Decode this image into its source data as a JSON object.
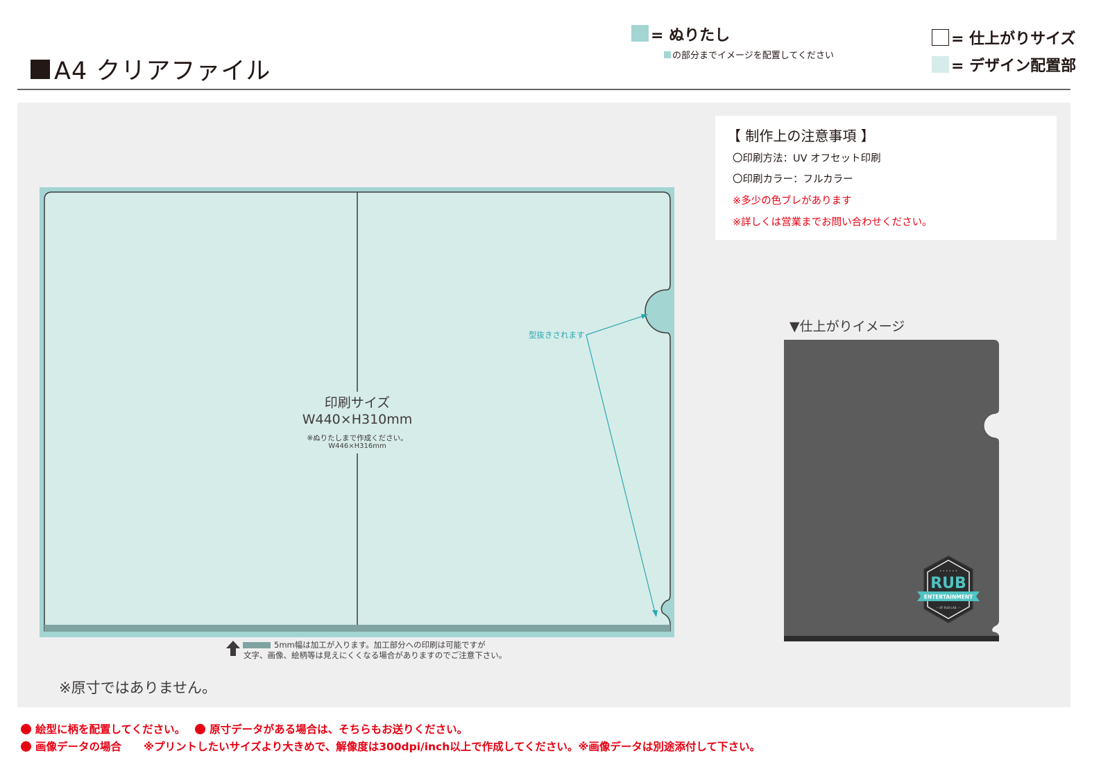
{
  "header": {
    "title": "A4 クリアファイル",
    "legend": {
      "bleed_label": "= ぬりたし",
      "bleed_note": "の部分までイメージを配置してください",
      "finish_label": "= 仕上がりサイズ",
      "design_label": "= デザイン配置部"
    }
  },
  "template": {
    "print_size_label": "印刷サイズ",
    "print_size_dims": "W440×H310mm",
    "bleed_note": "※ぬりたしまで作成ください。",
    "bleed_dims": "W446×H316mm",
    "diecut_label": "型抜きされます",
    "margin_note_1": "5mm幅は加工が入ります。加工部分への印刷は可能ですが",
    "margin_note_2": "文字、画像、絵柄等は見えにくくなる場合がありますのでご注意下さい。"
  },
  "not_actual_size": "※原寸ではありません。",
  "notes": {
    "heading": "【 制作上の注意事項 】",
    "lines": [
      "〇印刷方法：UV オフセット印刷",
      "〇印刷カラー：フルカラー",
      "※多少の色ブレがあります",
      "※詳しくは営業までお問い合わせください。"
    ]
  },
  "finish_image": {
    "label": "▼仕上がりイメージ",
    "logo_main": "RUB",
    "logo_banner": "ENTERTAINMENT",
    "logo_sub": "— BY RUB-LAB. —"
  },
  "footer": {
    "line1_a": "絵型に柄を配置してください。",
    "line1_b": "原寸データがある場合は、そちらもお送りください。",
    "line2_a": "画像データの場合",
    "line2_b": "※プリントしたいサイズより大きめで、解像度は300dpi/inch以上で作成してください。※画像データは別途添付して下さい。"
  },
  "colors": {
    "bleed": "#a3d5d3",
    "design_area": "#d6ece9",
    "panel_bg": "#efefef",
    "accent_teal": "#2ea7b0",
    "warning_red": "#e60012",
    "mockup_gray": "#5d5c5c"
  }
}
